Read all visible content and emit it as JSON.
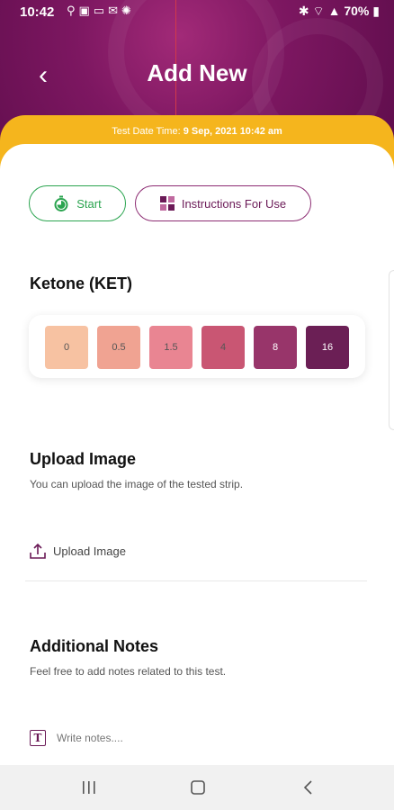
{
  "status_bar": {
    "time": "10:42",
    "left_icons": [
      "usb-icon",
      "image-icon",
      "cast-icon",
      "mail-icon",
      "sync-icon"
    ],
    "right_icons": [
      "bluetooth-icon",
      "alarm-icon",
      "wifi-icon",
      "signal-icon"
    ],
    "battery": "70%"
  },
  "header": {
    "title": "Add New",
    "date_label": "Test Date Time: ",
    "date_value": "9 Sep, 2021 10:42 am"
  },
  "actions": {
    "start_label": "Start",
    "instructions_label": "Instructions For Use"
  },
  "test": {
    "name": "Ketone (KET)",
    "swatches": [
      {
        "label": "0",
        "color": "#f7c2a2"
      },
      {
        "label": "0.5",
        "color": "#f0a392"
      },
      {
        "label": "1.5",
        "color": "#e98592"
      },
      {
        "label": "4",
        "color": "#c95673"
      },
      {
        "label": "8",
        "color": "#98356a"
      },
      {
        "label": "16",
        "color": "#6b1f55"
      }
    ]
  },
  "upload": {
    "title": "Upload Image",
    "subtitle": "You can upload the image of the tested strip.",
    "button_label": "Upload Image"
  },
  "notes": {
    "title": "Additional Notes",
    "subtitle": "Feel free to add notes related to this test.",
    "placeholder": "Write notes...."
  },
  "colors": {
    "brand_purple": "#7d1761",
    "accent_yellow": "#f5b51d",
    "start_green": "#2aa44f"
  }
}
